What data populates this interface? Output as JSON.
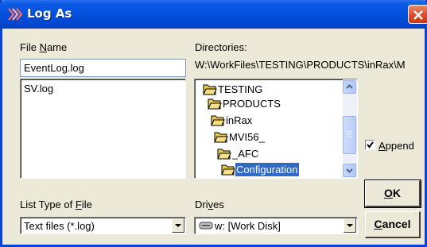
{
  "window": {
    "title": "Log As",
    "close_icon": "close-icon"
  },
  "file_name": {
    "label_pre": "File ",
    "label_u": "N",
    "label_post": "ame",
    "value": "EventLog.log",
    "files": [
      "SV.log"
    ]
  },
  "directories": {
    "label": "Directories:",
    "path": "W:\\WorkFiles\\TESTING\\PRODUCTS\\inRax\\M",
    "tree": [
      {
        "label": "TESTING",
        "selected": false
      },
      {
        "label": "PRODUCTS",
        "selected": false
      },
      {
        "label": "inRax",
        "selected": false
      },
      {
        "label": "MVI56_",
        "selected": false
      },
      {
        "label": "_AFC",
        "selected": false
      },
      {
        "label": "Configuration",
        "selected": true
      }
    ]
  },
  "list_type": {
    "label_pre": "List Type of ",
    "label_u": "F",
    "label_post": "ile",
    "value": "Text files (*.log)"
  },
  "drives": {
    "label_pre": "Dri",
    "label_u": "v",
    "label_post": "es",
    "value": "w: [Work Disk]"
  },
  "append": {
    "label_u": "A",
    "label_post": "ppend",
    "checked": true
  },
  "buttons": {
    "ok_u": "O",
    "ok_post": "K",
    "cancel_u": "C",
    "cancel_post": "ancel"
  },
  "colors": {
    "titlebar": "#0350dc",
    "selection": "#316ac5",
    "face": "#ece9d8"
  }
}
